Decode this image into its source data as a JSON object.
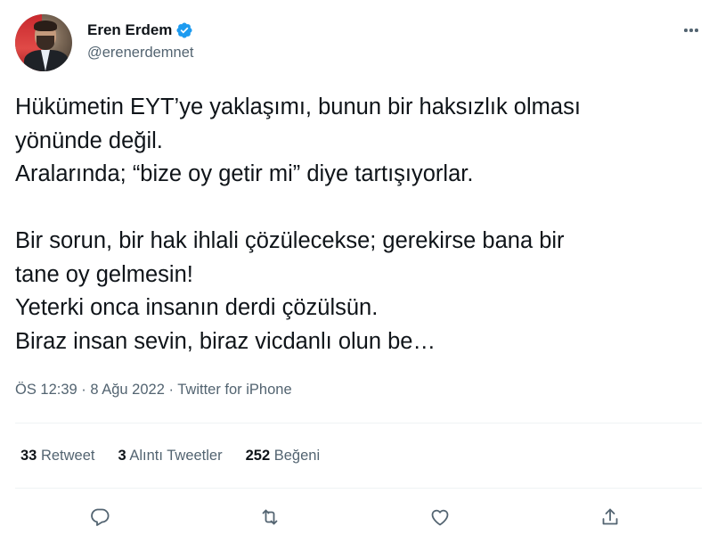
{
  "author": {
    "display_name": "Eren Erdem",
    "handle": "@erenerdemnet",
    "verified": true
  },
  "tweet": {
    "text": "Hükümetin EYT’ye yaklaşımı, bunun bir haksızlık olması\nyönünde değil.\nAralarında; “bize oy getir mi” diye tartışıyorlar.\n\nBir sorun, bir hak ihlali çözülecekse; gerekirse bana bir\ntane oy gelmesin!\nYeterki onca insanın derdi çözülsün.\nBiraz insan sevin, biraz vicdanlı olun be…",
    "meta": "ÖS 12:39 · 8 Ağu 2022 · Twitter for iPhone"
  },
  "stats": {
    "retweets": {
      "count": "33",
      "label": "Retweet"
    },
    "quotes": {
      "count": "3",
      "label": "Alıntı Tweetler"
    },
    "likes": {
      "count": "252",
      "label": "Beğeni"
    }
  },
  "actions": [
    "reply-icon",
    "retweet-icon",
    "like-icon",
    "share-icon"
  ],
  "colors": {
    "text": "#0f1419",
    "secondary": "#536471",
    "verified": "#1d9bf0",
    "divider": "#eff3f4"
  }
}
